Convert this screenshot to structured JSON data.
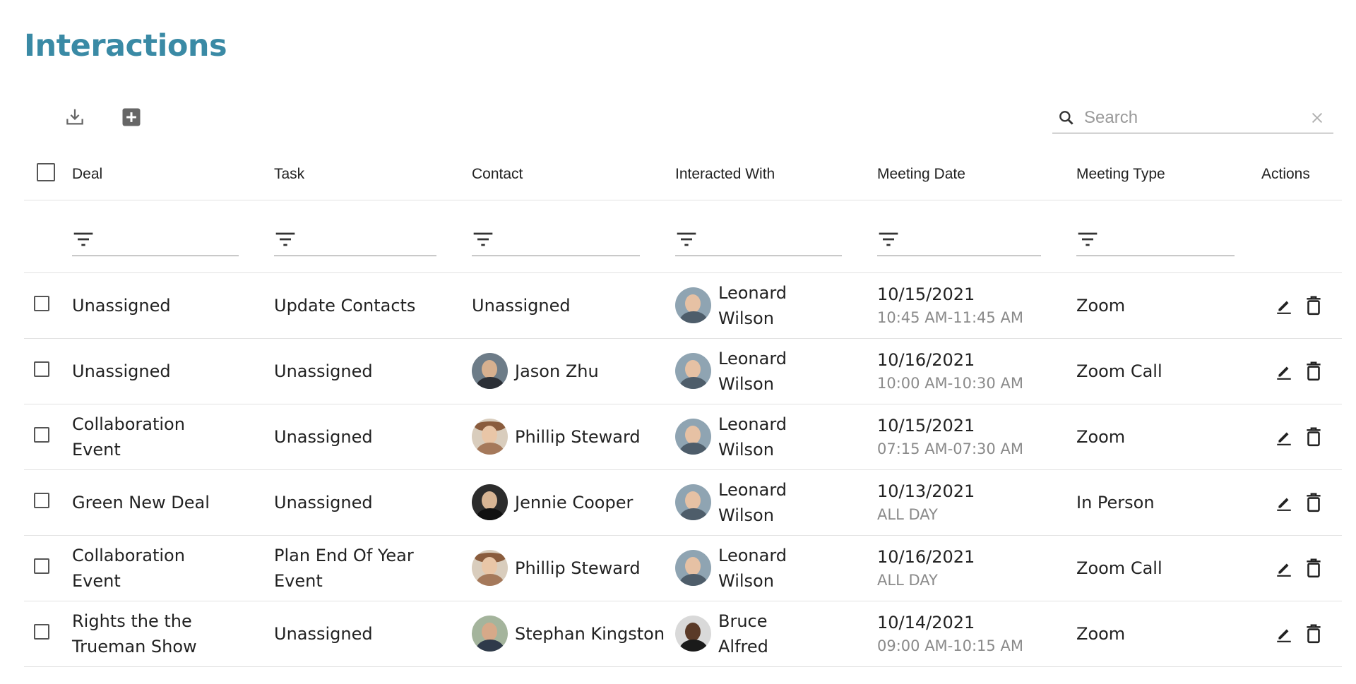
{
  "page": {
    "title": "Interactions"
  },
  "toolbar": {
    "download_icon": "download-icon",
    "add_icon": "add-box-icon"
  },
  "search": {
    "placeholder": "Search",
    "value": ""
  },
  "columns": [
    "Deal",
    "Task",
    "Contact",
    "Interacted With",
    "Meeting Date",
    "Meeting Type",
    "Actions"
  ],
  "rows": [
    {
      "deal": "Unassigned",
      "task": "Update Contacts",
      "contact": "Unassigned",
      "contact_avatar": "",
      "interacted": "Leonard Wilson",
      "date": "10/15/2021",
      "time": "10:45 AM-11:45 AM",
      "type": "Zoom"
    },
    {
      "deal": "Unassigned",
      "task": "Unassigned",
      "contact": "Jason Zhu",
      "contact_avatar": "jason",
      "interacted": "Leonard Wilson",
      "date": "10/16/2021",
      "time": "10:00 AM-10:30 AM",
      "type": "Zoom Call"
    },
    {
      "deal": "Collaboration Event",
      "task": "Unassigned",
      "contact": "Phillip Steward",
      "contact_avatar": "phillip",
      "interacted": "Leonard Wilson",
      "date": "10/15/2021",
      "time": "07:15 AM-07:30 AM",
      "type": "Zoom"
    },
    {
      "deal": "Green New Deal",
      "task": "Unassigned",
      "contact": "Jennie Cooper",
      "contact_avatar": "jennie",
      "interacted": "Leonard Wilson",
      "date": "10/13/2021",
      "time": "ALL DAY",
      "type": "In Person"
    },
    {
      "deal": "Collaboration Event",
      "task": "Plan End Of Year Event",
      "contact": "Phillip Steward",
      "contact_avatar": "phillip",
      "interacted": "Leonard Wilson",
      "date": "10/16/2021",
      "time": "ALL DAY",
      "type": "Zoom Call"
    },
    {
      "deal": "Rights the the Trueman Show",
      "task": "Unassigned",
      "contact": "Stephan Kingston",
      "contact_avatar": "stephan",
      "interacted": "Bruce Alfred",
      "date": "10/14/2021",
      "time": "09:00 AM-10:15 AM",
      "type": "Zoom"
    }
  ],
  "colors": {
    "title": "#3a8aa5",
    "muted": "#8a8a8a",
    "icon": "#555555"
  }
}
